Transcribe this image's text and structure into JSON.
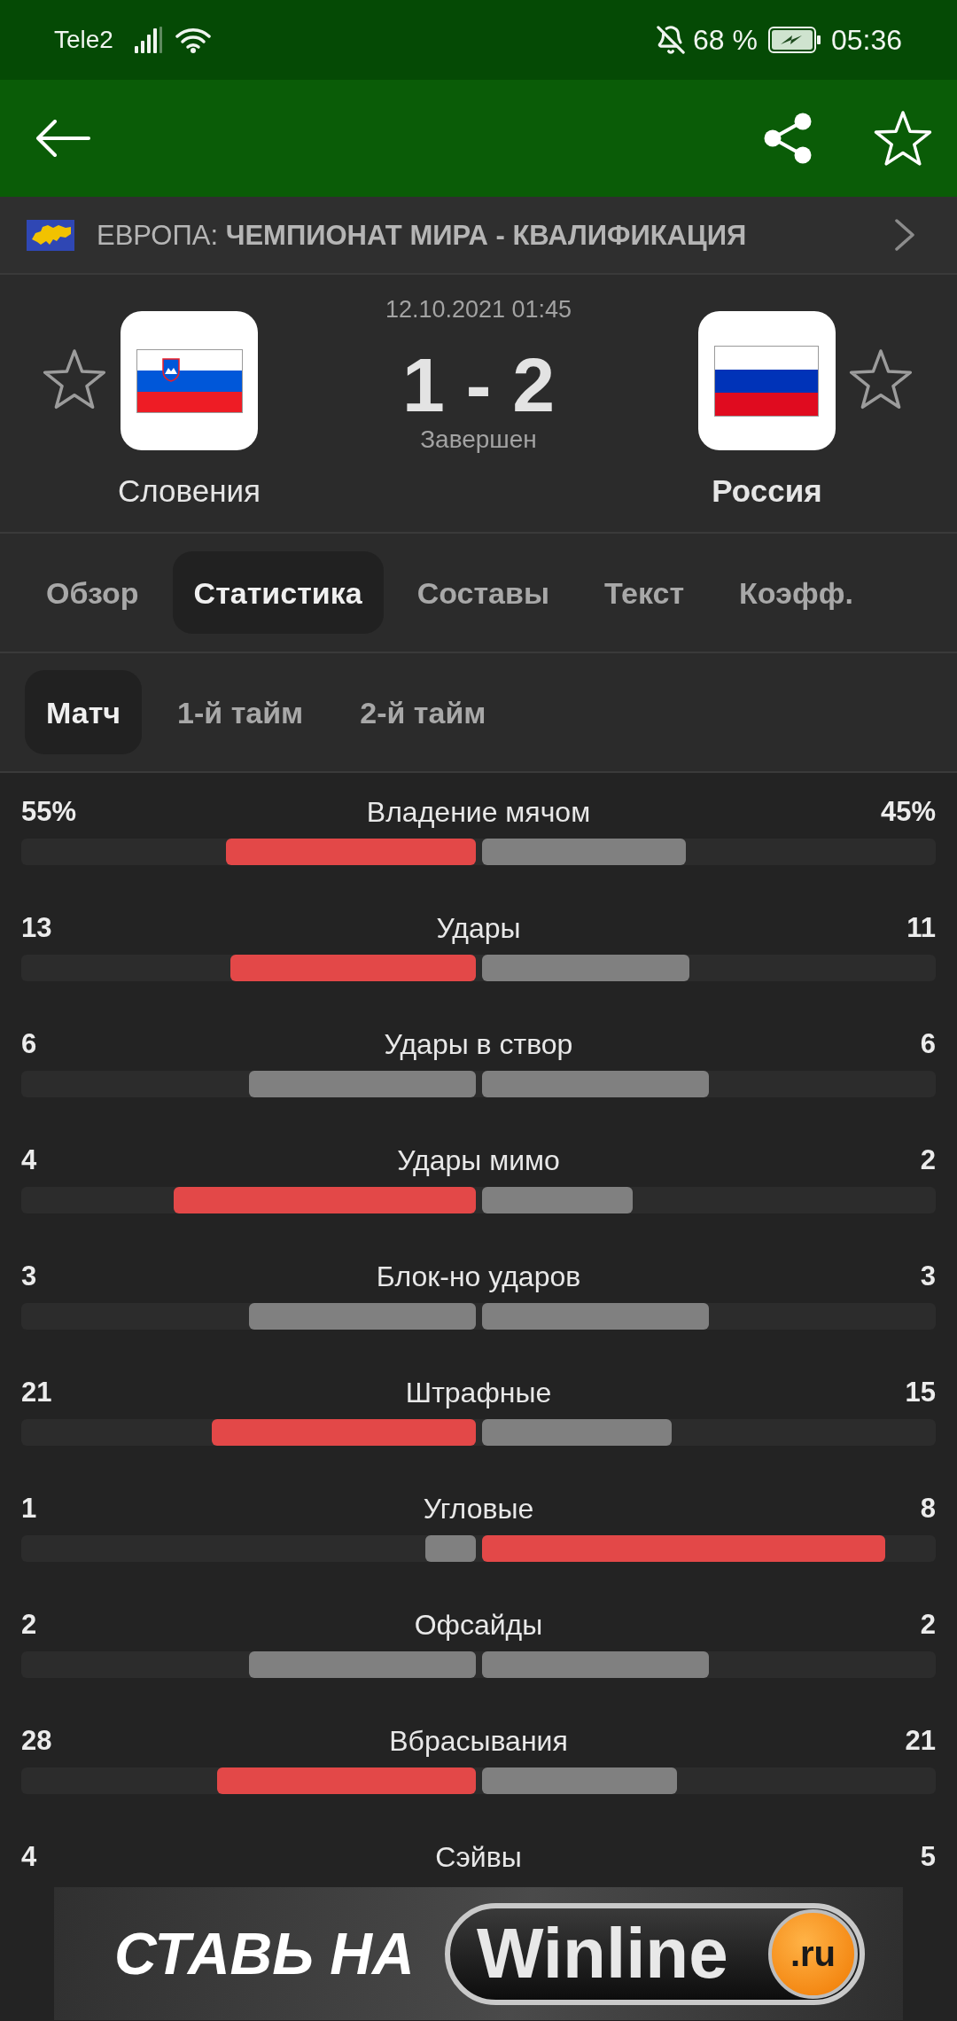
{
  "status_bar": {
    "carrier": "Tele2",
    "battery": "68 %",
    "time": "05:36"
  },
  "header": {
    "favorite": false
  },
  "competition": {
    "title": "ЕВРОПА: **ЧЕМПИОНАТ МИРА - КВАЛИФИКАЦИЯ**"
  },
  "match": {
    "date": "12.10.2021 01:45",
    "score": "1 - 2",
    "status": "Завершен",
    "home": {
      "name": "Словения",
      "winner": false,
      "favorite": false
    },
    "away": {
      "name": "Россия",
      "winner": true,
      "favorite": false
    }
  },
  "tabs": [
    {
      "label": "Обзор",
      "selected": false
    },
    {
      "label": "Статистика",
      "selected": true
    },
    {
      "label": "Составы",
      "selected": false
    },
    {
      "label": "Текст",
      "selected": false
    },
    {
      "label": "Коэфф.",
      "selected": false
    }
  ],
  "periods": [
    {
      "label": "Матч",
      "selected": true
    },
    {
      "label": "1-й тайм",
      "selected": false
    },
    {
      "label": "2-й тайм",
      "selected": false
    }
  ],
  "stats": [
    {
      "name": "Владение мячом",
      "home": {
        "value": "55%",
        "level": 0.55,
        "leading": true
      },
      "away": {
        "value": "45%",
        "level": 0.45,
        "leading": false
      }
    },
    {
      "name": "Удары",
      "home": {
        "value": "13",
        "level": 0.542,
        "leading": true
      },
      "away": {
        "value": "11",
        "level": 0.458,
        "leading": false
      }
    },
    {
      "name": "Удары в створ",
      "home": {
        "value": "6",
        "level": 0.5,
        "leading": false
      },
      "away": {
        "value": "6",
        "level": 0.5,
        "leading": false
      }
    },
    {
      "name": "Удары мимо",
      "home": {
        "value": "4",
        "level": 0.667,
        "leading": true
      },
      "away": {
        "value": "2",
        "level": 0.333,
        "leading": false
      }
    },
    {
      "name": "Блок-но ударов",
      "home": {
        "value": "3",
        "level": 0.5,
        "leading": false
      },
      "away": {
        "value": "3",
        "level": 0.5,
        "leading": false
      }
    },
    {
      "name": "Штрафные",
      "home": {
        "value": "21",
        "level": 0.583,
        "leading": true
      },
      "away": {
        "value": "15",
        "level": 0.417,
        "leading": false
      }
    },
    {
      "name": "Угловые",
      "home": {
        "value": "1",
        "level": 0.111,
        "leading": false
      },
      "away": {
        "value": "8",
        "level": 0.889,
        "leading": true
      }
    },
    {
      "name": "Офсайды",
      "home": {
        "value": "2",
        "level": 0.5,
        "leading": false
      },
      "away": {
        "value": "2",
        "level": 0.5,
        "leading": false
      }
    },
    {
      "name": "Вбрасывания",
      "home": {
        "value": "28",
        "level": 0.571,
        "leading": true
      },
      "away": {
        "value": "21",
        "level": 0.429,
        "leading": false
      }
    },
    {
      "name": "Сэйвы",
      "home": {
        "value": "4"
      },
      "away": {
        "value": "5"
      }
    }
  ],
  "ad": {
    "slogan": "СТАВЬ НА",
    "logo": "Winline",
    "domain": ".ru"
  }
}
